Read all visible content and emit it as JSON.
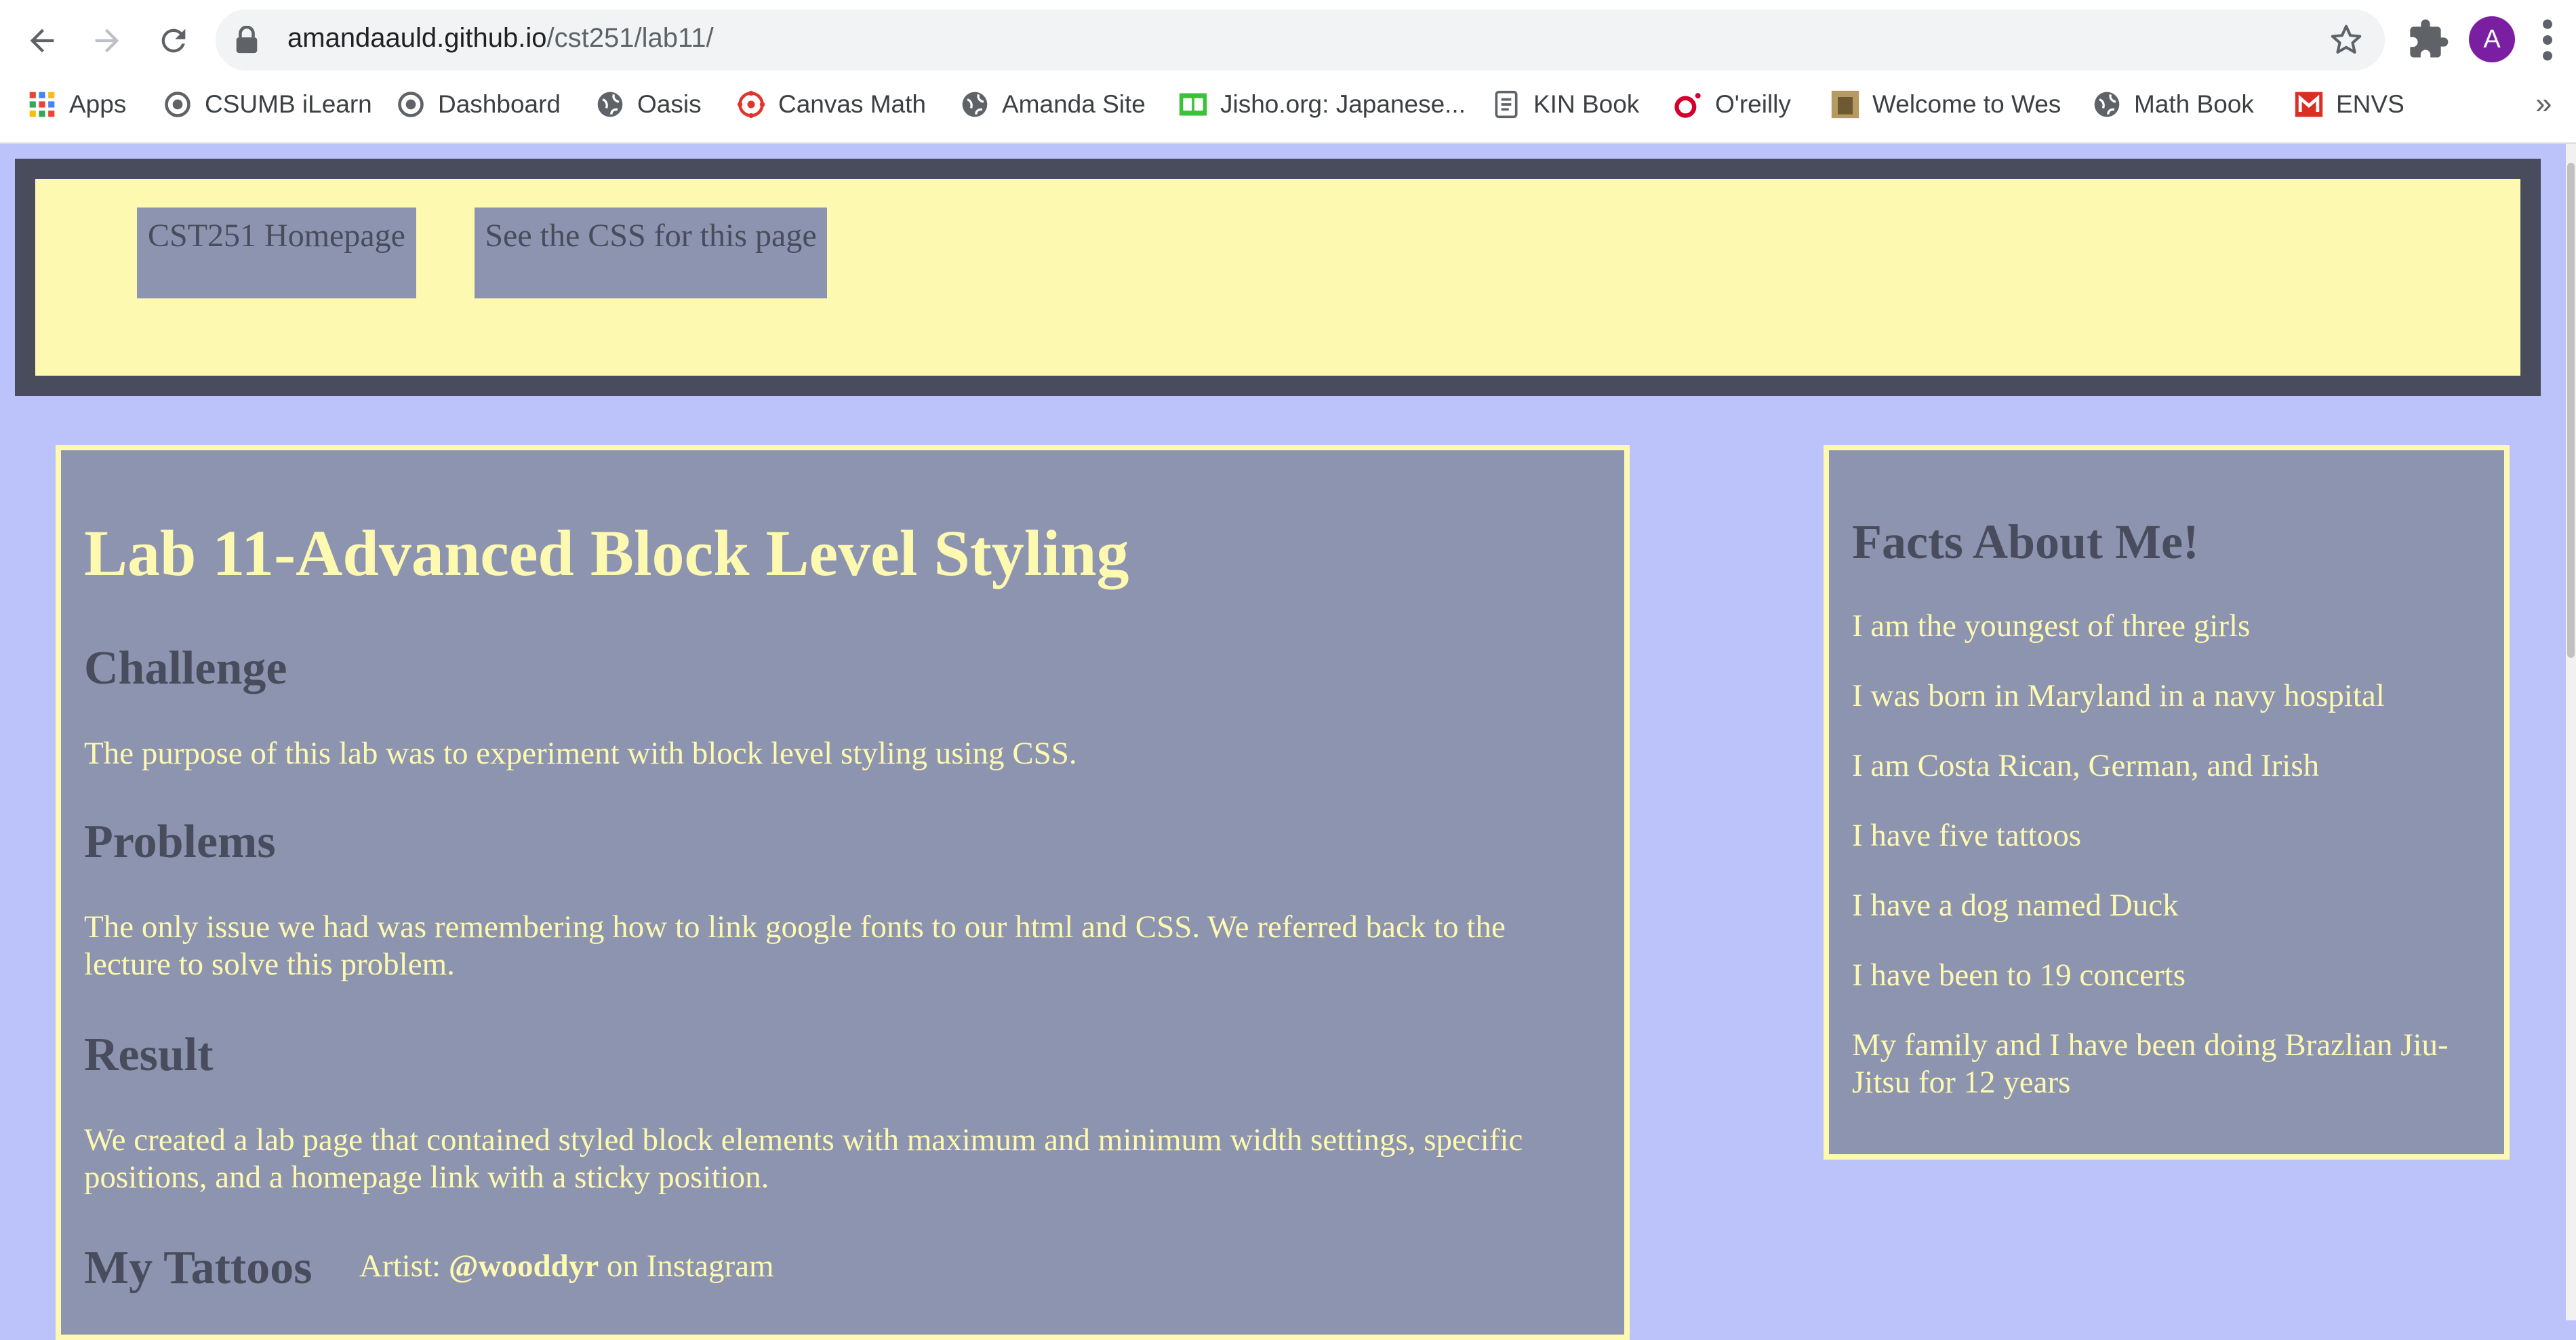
{
  "browser": {
    "url_host": "amandaauld.github.io",
    "url_path": "/cst251/lab11/",
    "avatar_letter": "A",
    "bookmarks": [
      {
        "label": "Apps",
        "icon": "apps-grid-icon"
      },
      {
        "label": "CSUMB iLearn",
        "icon": "ilearn-icon"
      },
      {
        "label": "Dashboard",
        "icon": "dashboard-icon"
      },
      {
        "label": "Oasis",
        "icon": "globe-icon"
      },
      {
        "label": "Canvas Math",
        "icon": "canvas-icon"
      },
      {
        "label": "Amanda Site",
        "icon": "globe-icon"
      },
      {
        "label": "Jisho.org: Japanese...",
        "icon": "jisho-icon"
      },
      {
        "label": "KIN Book",
        "icon": "document-icon"
      },
      {
        "label": "O'reilly",
        "icon": "oreilly-icon"
      },
      {
        "label": "Welcome to Wes",
        "icon": "wes-icon"
      },
      {
        "label": "Math Book",
        "icon": "globe-icon"
      },
      {
        "label": "ENVS",
        "icon": "gmail-icon"
      }
    ],
    "more_label": "»"
  },
  "header": {
    "home_button": "CST251 Homepage",
    "css_button": "See the CSS for this page"
  },
  "main": {
    "title": "Lab 11-Advanced Block Level Styling",
    "challenge_heading": "Challenge",
    "challenge_text": "The purpose of this lab was to experiment with block level styling using CSS.",
    "problems_heading": "Problems",
    "problems_text": "The only issue we had was remembering how to link google fonts to our html and CSS. We referred back to the lecture to solve this problem.",
    "result_heading": "Result",
    "result_text": "We created a lab page that contained styled block elements with maximum and minimum width settings, specific positions, and a homepage link with a sticky position.",
    "tattoos_heading": "My Tattoos",
    "artist_prefix": "Artist: ",
    "artist_handle": "@wooddyr",
    "artist_suffix": " on Instagram"
  },
  "facts": {
    "heading": "Facts About Me!",
    "items": [
      "I am the youngest of three girls",
      "I was born in Maryland in a navy hospital",
      "I am Costa Rican, German, and Irish",
      "I have five tattoos",
      "I have a dog named Duck",
      "I have been to 19 concerts",
      "My family and I have been doing Brazlian Jiu-Jitsu for 12 years"
    ]
  },
  "colors": {
    "page_bg": "#bcc3fb",
    "panel_bg": "#8d94b0",
    "accent_yellow": "#fdf9b1",
    "dark_slate": "#484c5c"
  }
}
